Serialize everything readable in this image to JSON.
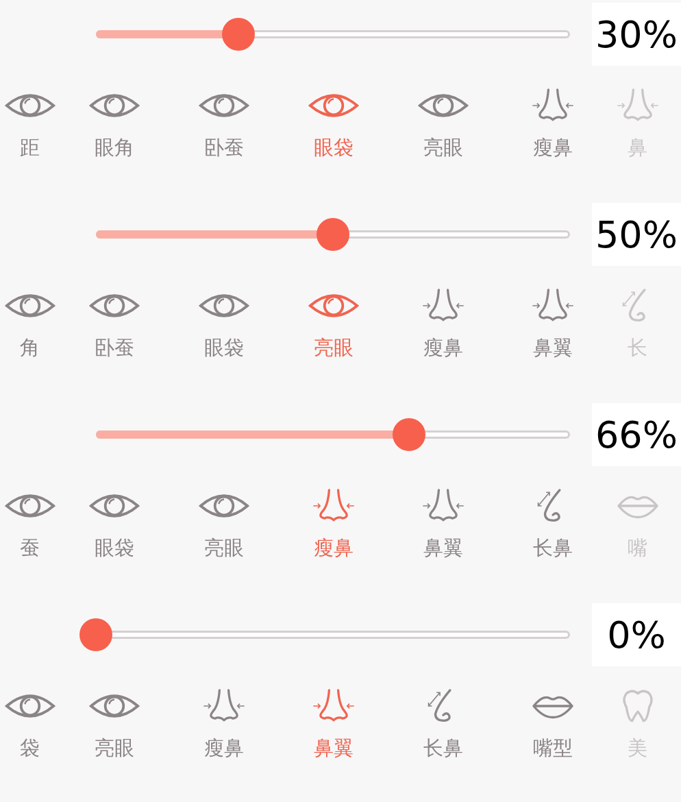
{
  "panels": [
    {
      "slider": {
        "level": 0.3,
        "reading": "30%"
      },
      "items": [
        {
          "kind": "eye",
          "label": "距",
          "selected": false
        },
        {
          "kind": "eye",
          "label": "眼角",
          "selected": false
        },
        {
          "kind": "eye",
          "label": "卧蚕",
          "selected": false
        },
        {
          "kind": "eye",
          "label": "眼袋",
          "selected": true
        },
        {
          "kind": "eye",
          "label": "亮眼",
          "selected": false
        },
        {
          "kind": "nose",
          "label": "瘦鼻",
          "selected": false
        },
        {
          "kind": "nose",
          "label": "鼻",
          "selected": false
        }
      ]
    },
    {
      "slider": {
        "level": 0.5,
        "reading": "50%"
      },
      "items": [
        {
          "kind": "eye",
          "label": "角",
          "selected": false
        },
        {
          "kind": "eye",
          "label": "卧蚕",
          "selected": false
        },
        {
          "kind": "eye",
          "label": "眼袋",
          "selected": false
        },
        {
          "kind": "eye",
          "label": "亮眼",
          "selected": true
        },
        {
          "kind": "nose",
          "label": "瘦鼻",
          "selected": false
        },
        {
          "kind": "nose",
          "label": "鼻翼",
          "selected": false
        },
        {
          "kind": "nose-long",
          "label": "长",
          "selected": false
        }
      ]
    },
    {
      "slider": {
        "level": 0.66,
        "reading": "66%"
      },
      "items": [
        {
          "kind": "eye",
          "label": "蚕",
          "selected": false
        },
        {
          "kind": "eye",
          "label": "眼袋",
          "selected": false
        },
        {
          "kind": "eye",
          "label": "亮眼",
          "selected": false
        },
        {
          "kind": "nose",
          "label": "瘦鼻",
          "selected": true
        },
        {
          "kind": "nose",
          "label": "鼻翼",
          "selected": false
        },
        {
          "kind": "nose-long",
          "label": "长鼻",
          "selected": false
        },
        {
          "kind": "lips",
          "label": "嘴",
          "selected": false
        }
      ]
    },
    {
      "slider": {
        "level": 0,
        "reading": "0%"
      },
      "items": [
        {
          "kind": "eye",
          "label": "袋",
          "selected": false
        },
        {
          "kind": "eye",
          "label": "亮眼",
          "selected": false
        },
        {
          "kind": "nose",
          "label": "瘦鼻",
          "selected": false
        },
        {
          "kind": "nose",
          "label": "鼻翼",
          "selected": true
        },
        {
          "kind": "nose-long",
          "label": "长鼻",
          "selected": false
        },
        {
          "kind": "lips",
          "label": "嘴型",
          "selected": false
        },
        {
          "kind": "tooth",
          "label": "美",
          "selected": false
        }
      ]
    }
  ]
}
